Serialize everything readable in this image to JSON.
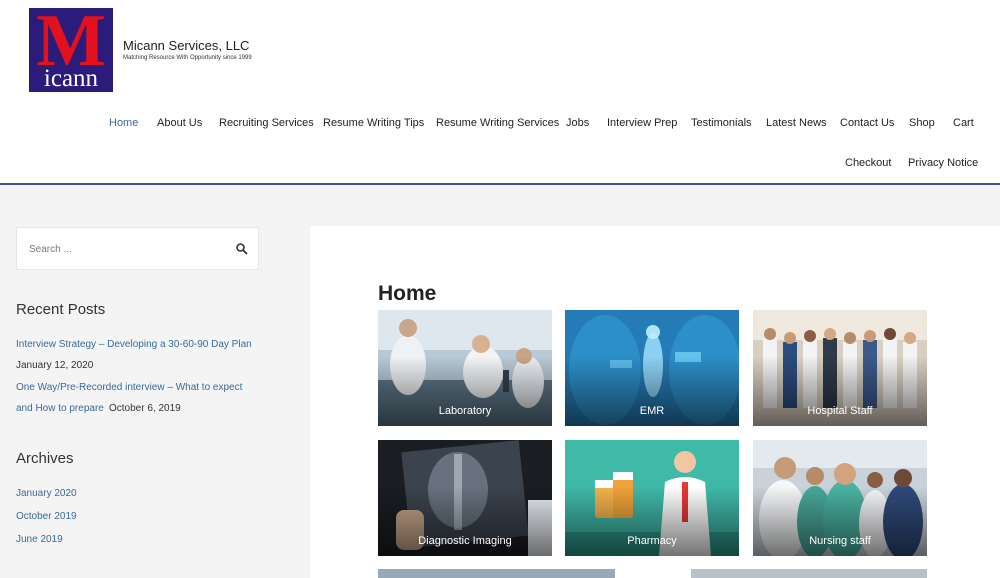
{
  "header": {
    "logo_letter": "M",
    "logo_text": "icann",
    "site_title": "Micann Services, LLC",
    "tagline": "Matching Resource With Opportunity since 1999"
  },
  "nav": {
    "items": [
      {
        "label": "Home",
        "active": true
      },
      {
        "label": "About Us"
      },
      {
        "label": "Recruiting Services"
      },
      {
        "label": "Resume Writing Tips"
      },
      {
        "label": "Resume Writing Services"
      },
      {
        "label": "Jobs"
      },
      {
        "label": "Interview Prep"
      },
      {
        "label": "Testimonials"
      },
      {
        "label": "Latest News"
      },
      {
        "label": "Contact Us"
      },
      {
        "label": "Shop"
      },
      {
        "label": "Cart"
      },
      {
        "label": "Checkout"
      },
      {
        "label": "Privacy Notice"
      }
    ]
  },
  "sidebar": {
    "search": {
      "placeholder": "Search ..."
    },
    "recent_posts": {
      "title": "Recent Posts",
      "posts": [
        {
          "title": "Interview Strategy – Developing a 30-60-90 Day Plan",
          "date": "January 12, 2020"
        },
        {
          "title_line1": "One Way/Pre-Recorded interview – What to expect",
          "title_line2": "and How to prepare",
          "date": "October 6, 2019"
        }
      ]
    },
    "archives": {
      "title": "Archives",
      "items": [
        "January 2020",
        "October 2019",
        "June 2019"
      ]
    }
  },
  "main": {
    "page_title": "Home",
    "tiles": [
      {
        "label": "Laboratory"
      },
      {
        "label": "EMR"
      },
      {
        "label": "Hospital Staff"
      },
      {
        "label": "Diagnostic Imaging"
      },
      {
        "label": "Pharmacy"
      },
      {
        "label": "Nursing staff"
      }
    ]
  }
}
